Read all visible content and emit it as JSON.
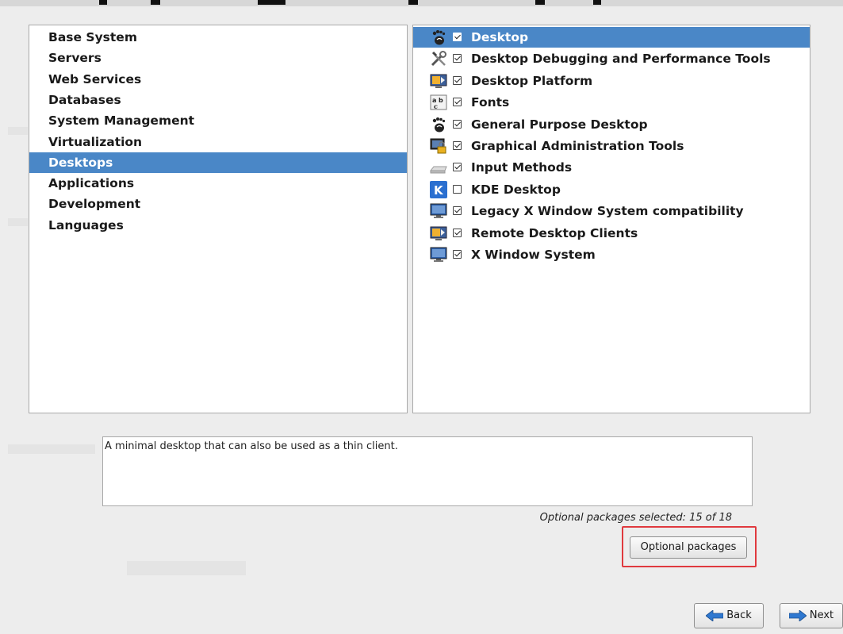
{
  "categories": [
    {
      "label": "Base System",
      "selected": false
    },
    {
      "label": "Servers",
      "selected": false
    },
    {
      "label": "Web Services",
      "selected": false
    },
    {
      "label": "Databases",
      "selected": false
    },
    {
      "label": "System Management",
      "selected": false
    },
    {
      "label": "Virtualization",
      "selected": false
    },
    {
      "label": "Desktops",
      "selected": true
    },
    {
      "label": "Applications",
      "selected": false
    },
    {
      "label": "Development",
      "selected": false
    },
    {
      "label": "Languages",
      "selected": false
    }
  ],
  "groups": [
    {
      "label": "Desktop",
      "checked": true,
      "selected": true,
      "icon": "gnome-foot-icon"
    },
    {
      "label": "Desktop Debugging and Performance Tools",
      "checked": true,
      "selected": false,
      "icon": "tools-icon"
    },
    {
      "label": "Desktop Platform",
      "checked": true,
      "selected": false,
      "icon": "platform-icon"
    },
    {
      "label": "Fonts",
      "checked": true,
      "selected": false,
      "icon": "fonts-icon"
    },
    {
      "label": "General Purpose Desktop",
      "checked": true,
      "selected": false,
      "icon": "gnome-foot-icon"
    },
    {
      "label": "Graphical Administration Tools",
      "checked": true,
      "selected": false,
      "icon": "admin-lock-icon"
    },
    {
      "label": "Input Methods",
      "checked": true,
      "selected": false,
      "icon": "keyboard-icon"
    },
    {
      "label": "KDE Desktop",
      "checked": false,
      "selected": false,
      "icon": "kde-icon"
    },
    {
      "label": "Legacy X Window System compatibility",
      "checked": true,
      "selected": false,
      "icon": "monitor-icon"
    },
    {
      "label": "Remote Desktop Clients",
      "checked": true,
      "selected": false,
      "icon": "platform-icon"
    },
    {
      "label": "X Window System",
      "checked": true,
      "selected": false,
      "icon": "monitor-icon"
    }
  ],
  "description": "A minimal desktop that can also be used as a thin client.",
  "optional_summary": "Optional packages selected: 15 of 18",
  "buttons": {
    "optional_packages": "Optional packages",
    "back": "Back",
    "next": "Next"
  },
  "colors": {
    "selection": "#4a87c7",
    "highlight_border": "#e0393e",
    "background": "#ededed"
  }
}
